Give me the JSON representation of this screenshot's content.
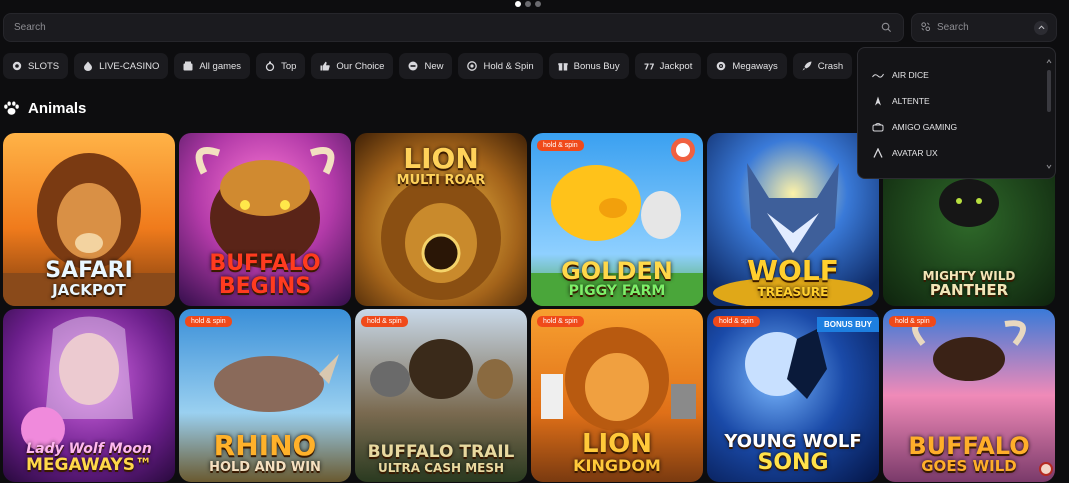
{
  "carousel": {
    "dot_count": 3,
    "active_index": 0
  },
  "search": {
    "placeholder": "Search",
    "icon": "search-icon"
  },
  "provider_filter": {
    "placeholder": "Search",
    "icon": "provider-icon"
  },
  "categories": [
    {
      "label": "SLOTS",
      "icon": "slots-icon"
    },
    {
      "label": "LIVE-CASINO",
      "icon": "live-casino-icon"
    },
    {
      "label": "All games",
      "icon": "all-games-icon"
    },
    {
      "label": "Top",
      "icon": "top-icon"
    },
    {
      "label": "Our Choice",
      "icon": "thumbs-up-icon"
    },
    {
      "label": "New",
      "icon": "new-icon"
    },
    {
      "label": "Hold & Spin",
      "icon": "hold-spin-icon"
    },
    {
      "label": "Bonus Buy",
      "icon": "bonus-buy-icon"
    },
    {
      "label": "Jackpot",
      "icon": "jackpot-icon"
    },
    {
      "label": "Megaways",
      "icon": "megaways-icon"
    },
    {
      "label": "Crash",
      "icon": "rocket-icon"
    },
    {
      "label": "",
      "icon": "more-icon"
    }
  ],
  "section": {
    "title": "Animals",
    "icon": "paw-icon"
  },
  "providers_dropdown": {
    "items": [
      {
        "label": "AIR DICE",
        "icon": "air-dice-icon"
      },
      {
        "label": "ALTENTE",
        "icon": "altente-icon"
      },
      {
        "label": "AMIGO GAMING",
        "icon": "amigo-gaming-icon"
      },
      {
        "label": "AVATAR UX",
        "icon": "avatar-ux-icon"
      }
    ]
  },
  "games": [
    {
      "line1": "SAFARI",
      "line2": "JACKPOT",
      "badge": "",
      "badge_buy": "",
      "title_color": "#e9f7ff"
    },
    {
      "line1": "BUFFALO",
      "line2": "BEGINS",
      "badge": "",
      "badge_buy": "",
      "title_color": "#ff3b1f"
    },
    {
      "line1": "LION",
      "line2": "MULTI ROAR",
      "badge": "",
      "badge_buy": "",
      "title_color": "#ffd25a"
    },
    {
      "line1": "GOLDEN",
      "line2": "PIGGY FARM",
      "badge": "hold & spin",
      "badge_buy": "",
      "title_color": "#ffd84a"
    },
    {
      "line1": "WOLF",
      "line2": "TREASURE",
      "badge": "",
      "badge_buy": "",
      "title_color": "#ffcf2e"
    },
    {
      "line1": "MIGHTY WILD",
      "line2": "PANTHER",
      "badge": "",
      "badge_buy": "",
      "title_color": "#f2e6b8"
    },
    {
      "line1": "Lady Wolf Moon",
      "line2": "MEGAWAYS™",
      "badge": "",
      "badge_buy": "",
      "title_color": "#ffd84a"
    },
    {
      "line1": "RHINO",
      "line2": "HOLD AND WIN",
      "badge": "hold & spin",
      "badge_buy": "",
      "title_color": "#ffb12a"
    },
    {
      "line1": "BUFFALO TRAIL",
      "line2": "ULTRA CASH MESH",
      "badge": "hold & spin",
      "badge_buy": "",
      "title_color": "#e8d9a0"
    },
    {
      "line1": "LION",
      "line2": "KINGDOM",
      "badge": "hold & spin",
      "badge_buy": "",
      "title_color": "#ffc93a"
    },
    {
      "line1": "YOUNG WOLF",
      "line2": "SONG",
      "badge": "hold & spin",
      "badge_buy": "BONUS BUY",
      "title_color": "#ffe14a"
    },
    {
      "line1": "BUFFALO",
      "line2": "GOES WILD",
      "badge": "hold & spin",
      "badge_buy": "",
      "title_color": "#ffae2a"
    }
  ]
}
